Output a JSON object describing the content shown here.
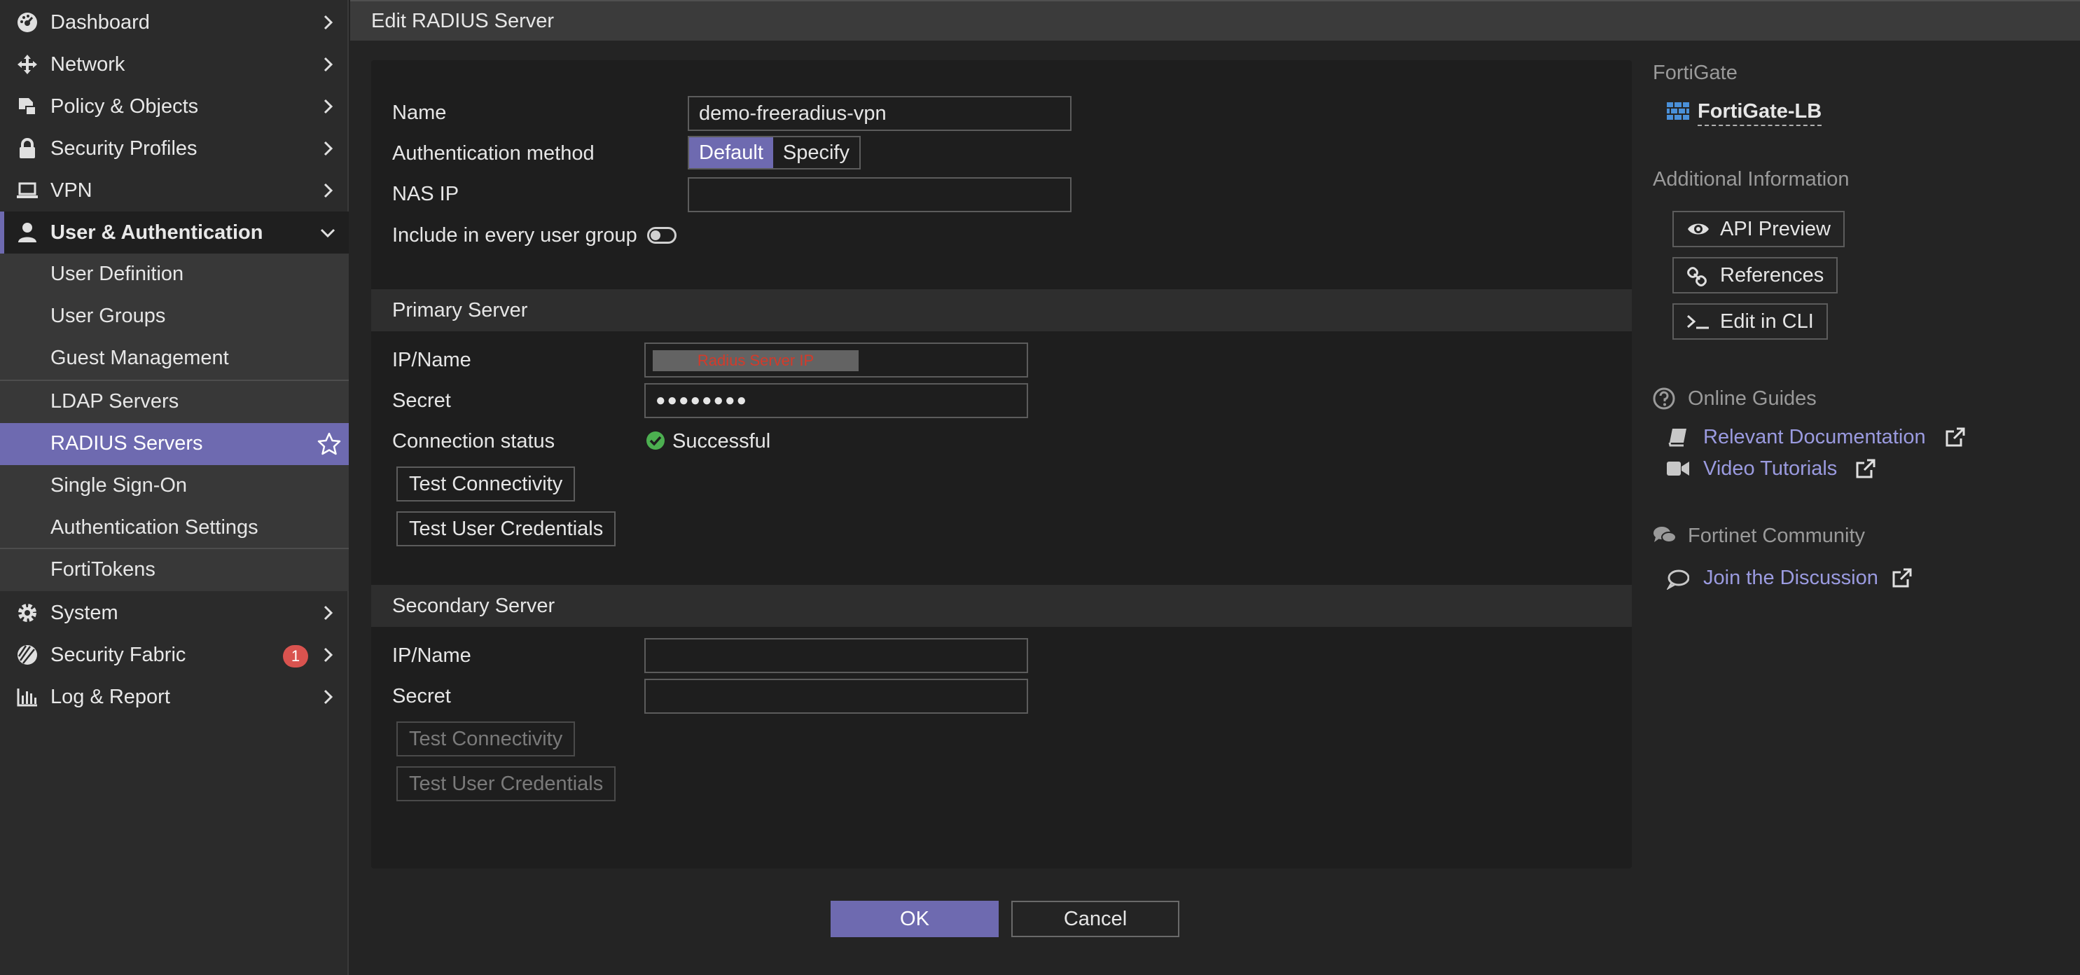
{
  "sidebar": {
    "items": [
      {
        "label": "Dashboard",
        "icon": "dashboard-icon"
      },
      {
        "label": "Network",
        "icon": "network-move-icon"
      },
      {
        "label": "Policy & Objects",
        "icon": "policy-objects-icon"
      },
      {
        "label": "Security Profiles",
        "icon": "lock-icon"
      },
      {
        "label": "VPN",
        "icon": "laptop-icon"
      },
      {
        "label": "User & Authentication",
        "icon": "user-icon"
      },
      {
        "label": "System",
        "icon": "gear-icon"
      },
      {
        "label": "Security Fabric",
        "icon": "fabric-icon",
        "badge": "1"
      },
      {
        "label": "Log & Report",
        "icon": "bar-chart-icon"
      }
    ],
    "sub_items": [
      {
        "label": "User Definition"
      },
      {
        "label": "User Groups"
      },
      {
        "label": "Guest Management"
      },
      {
        "label": "LDAP Servers"
      },
      {
        "label": "RADIUS Servers"
      },
      {
        "label": "Single Sign-On"
      },
      {
        "label": "Authentication Settings"
      },
      {
        "label": "FortiTokens"
      }
    ]
  },
  "title": "Edit RADIUS Server",
  "form": {
    "name_label": "Name",
    "name_value": "demo-freeradius-vpn",
    "auth_method_label": "Authentication method",
    "auth_method_options": [
      "Default",
      "Specify"
    ],
    "nas_ip_label": "NAS IP",
    "nas_ip_value": "",
    "include_label": "Include in every user group",
    "include_enabled": false
  },
  "primary": {
    "heading": "Primary Server",
    "ip_label": "IP/Name",
    "ip_value": "Radius Server IP",
    "secret_label": "Secret",
    "secret_value": "●●●●●●●●",
    "status_label": "Connection status",
    "status_value": "Successful",
    "test_connectivity": "Test Connectivity",
    "test_credentials": "Test User Credentials"
  },
  "secondary": {
    "heading": "Secondary Server",
    "ip_label": "IP/Name",
    "ip_value": "",
    "secret_label": "Secret",
    "secret_value": "",
    "test_connectivity": "Test Connectivity",
    "test_credentials": "Test User Credentials"
  },
  "footer": {
    "ok": "OK",
    "cancel": "Cancel"
  },
  "info": {
    "device_heading": "FortiGate",
    "device_name": "FortiGate-LB",
    "additional_heading": "Additional Information",
    "api_preview": "API Preview",
    "references": "References",
    "edit_cli": "Edit in CLI",
    "guides_heading": "Online Guides",
    "relevant_docs": "Relevant Documentation",
    "video_tutorials": "Video Tutorials",
    "community_heading": "Fortinet Community",
    "join_discussion": "Join the Discussion"
  },
  "colors": {
    "accent": "#6e6ab0",
    "link": "#9b9be0",
    "success": "#4caf50",
    "badge": "#d9534f"
  }
}
